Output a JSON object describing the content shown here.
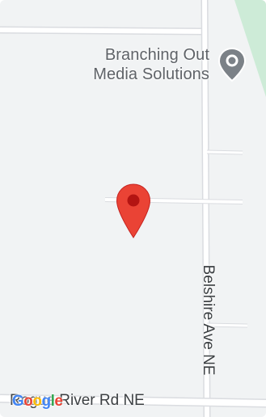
{
  "map": {
    "poi": {
      "name_line1": "Branching Out",
      "name_line2": "Media Solutions",
      "icon": "place-pin-icon"
    },
    "main_marker": {
      "icon": "red-map-marker-icon",
      "color": "#ea4335",
      "dot_color": "#b31412"
    },
    "streets": {
      "vertical": "Belshire Ave NE",
      "horizontal": "Rogue River Rd NE"
    },
    "colors": {
      "background": "#f1f3f4",
      "road_fill": "#ffffff",
      "road_outline": "#dadce0",
      "park": "#cdebd7",
      "poi_pin": "#7b8187",
      "label_gray": "#5f6368",
      "street_label": "#3c4043"
    },
    "attribution": {
      "logo_text": "Google",
      "logo_colors": [
        "#4285f4",
        "#ea4335",
        "#fbbc05",
        "#4285f4",
        "#34a853",
        "#ea4335"
      ]
    }
  }
}
